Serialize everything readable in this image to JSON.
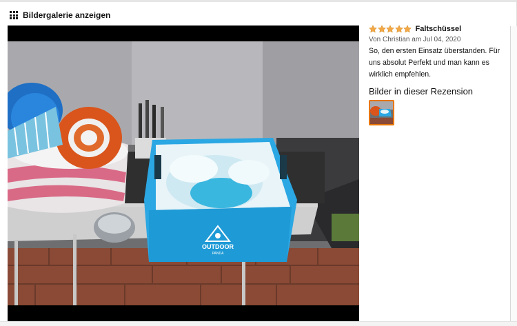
{
  "header": {
    "gallery_label": "Bildergalerie anzeigen",
    "icon": "grid-icon"
  },
  "review": {
    "rating": 5,
    "rating_max": 5,
    "star_color": "#f3a847",
    "title": "Faltschüssel",
    "byline": "Von Christian am Jul 04, 2020",
    "body": "So, den ersten Einsatz überstanden. Für uns absolut Perfekt und man kann es wirklich empfehlen.",
    "images_heading": "Bilder in dieser Rezension"
  },
  "product_print": {
    "brand_line1": "OUTDOOR",
    "brand_line2": "PANDA"
  },
  "colors": {
    "thumb_border": "#e77600",
    "tub_blue": "#2ba7e3"
  }
}
